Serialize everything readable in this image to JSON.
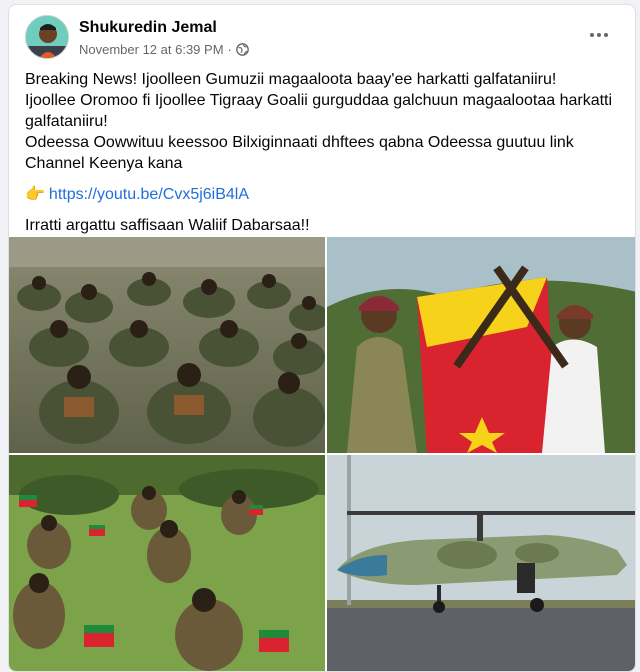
{
  "post": {
    "author": "Shukuredin Jemal",
    "timestamp": "November 12 at 6:39 PM",
    "separator": "·",
    "visibility_icon": "globe-icon",
    "more_icon": "more-options-icon"
  },
  "content": {
    "line1": "Breaking News! Ijoolleen Gumuzii magaaloota baay'ee harkatti galfataniiru!",
    "line2": "Ijoollee Oromoo fi Ijoollee Tigraay Goalii gurguddaa galchuun magaalootaa harkatti galfataniiru!",
    "line3": "Odeessa Oowwituu keessoo Bilxiginnaati dhftees qabna Odeessa guutuu link Channel Keenya kana",
    "link_icon": "pointing-hand-icon",
    "link_text": "https://youtu.be/Cvx5j6iB4lA",
    "line4": "Irratti argattu saffisaan Waliif Dabarsaa!!"
  },
  "photos": [
    {
      "name": "seated-soldiers-photo"
    },
    {
      "name": "fighters-with-flag-photo"
    },
    {
      "name": "soldiers-in-field-photo"
    },
    {
      "name": "helicopter-photo"
    }
  ],
  "colors": {
    "link": "#216fdb",
    "muted": "#65676b",
    "flag_red": "#d9232e",
    "flag_yellow": "#f6d21a"
  }
}
